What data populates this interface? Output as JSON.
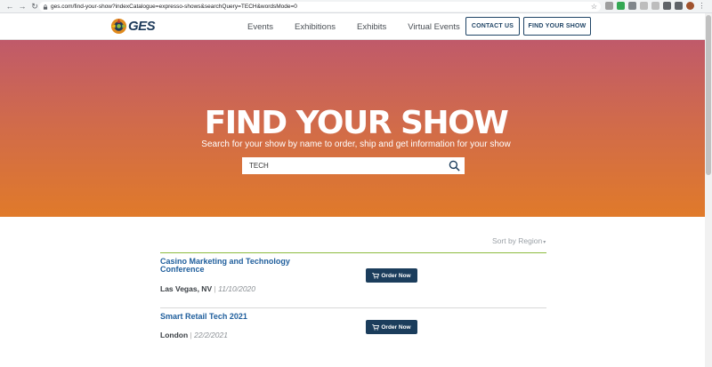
{
  "browser": {
    "url": "ges.com/find-your-show?indexCatalogue=expresso-shows&searchQuery=TECH&wordsMode=0"
  },
  "header": {
    "logo_text": "GES",
    "nav": [
      "Events",
      "Exhibitions",
      "Exhibits",
      "Virtual Events"
    ],
    "contact_label": "CONTACT US",
    "find_show_label": "FIND YOUR SHOW"
  },
  "hero": {
    "title": "FIND YOUR SHOW",
    "subtitle": "Search for your show by name to order, ship and get information for your show",
    "search_value": "TECH"
  },
  "results": {
    "sort_label": "Sort by Region",
    "items": [
      {
        "title": "Casino Marketing and Technology Conference",
        "city": "Las Vegas, NV",
        "date": "11/10/2020",
        "button": "Order Now"
      },
      {
        "title": "Smart Retail Tech 2021",
        "city": "London",
        "date": "22/2/2021",
        "button": "Order Now"
      }
    ]
  },
  "colors": {
    "brand_navy": "#1b3d5c",
    "link_blue": "#1f5e9c",
    "accent_green": "#8dbb3f",
    "hero_top": "#c05a6a",
    "hero_bottom": "#e07a2a"
  }
}
